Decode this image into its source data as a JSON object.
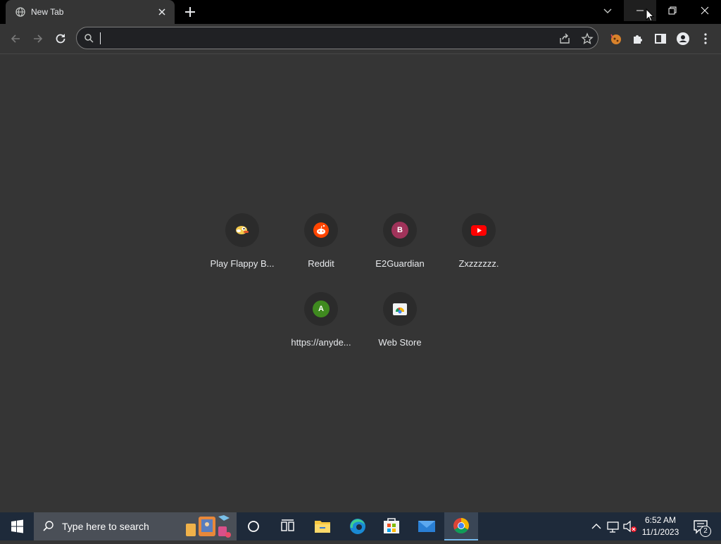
{
  "browser": {
    "tab": {
      "title": "New Tab"
    },
    "omnibox": {
      "value": "",
      "placeholder": ""
    }
  },
  "shortcuts": [
    {
      "label": "Play Flappy B...",
      "icon": "flappy-bird-icon"
    },
    {
      "label": "Reddit",
      "icon": "reddit-icon"
    },
    {
      "label": "E2Guardian",
      "icon": "letter-b-icon",
      "letter": "B",
      "color": "#a0335a"
    },
    {
      "label": "Zxzzzzzz.",
      "icon": "youtube-icon"
    },
    {
      "label": "https://anyde...",
      "icon": "letter-a-icon",
      "letter": "A",
      "color": "#3f8a1f"
    },
    {
      "label": "Web Store",
      "icon": "web-store-icon"
    }
  ],
  "taskbar": {
    "search_placeholder": "Type here to search",
    "time": "6:52 AM",
    "date": "11/1/2023",
    "notification_count": "2"
  },
  "colors": {
    "background": "#353535",
    "tabstrip": "#000000",
    "taskbar": "#1e2a3a",
    "accent": "#76b9ed"
  }
}
